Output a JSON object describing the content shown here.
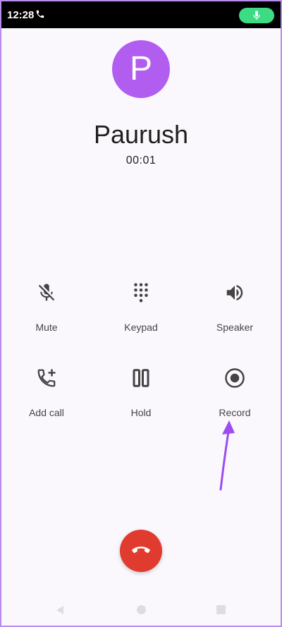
{
  "status_bar": {
    "time": "12:28",
    "call_icon": "phone-icon",
    "mic_icon": "mic-icon"
  },
  "caller": {
    "avatar_letter": "P",
    "name": "Paurush",
    "timer": "00:01"
  },
  "controls": {
    "mute": {
      "label": "Mute",
      "icon": "mic-off-icon"
    },
    "keypad": {
      "label": "Keypad",
      "icon": "dialpad-icon"
    },
    "speaker": {
      "label": "Speaker",
      "icon": "speaker-icon"
    },
    "add_call": {
      "label": "Add call",
      "icon": "add-call-icon"
    },
    "hold": {
      "label": "Hold",
      "icon": "pause-icon"
    },
    "record": {
      "label": "Record",
      "icon": "record-icon"
    }
  },
  "end_call": {
    "icon": "hang-up-icon",
    "color": "#e03b2f"
  },
  "colors": {
    "avatar": "#b15df0",
    "mic_pill": "#3ddc84",
    "annotation_arrow": "#9b4df0"
  }
}
